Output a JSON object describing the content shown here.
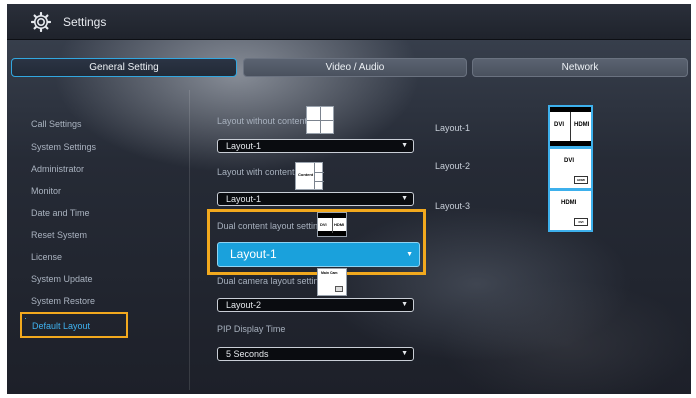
{
  "window": {
    "title": "Settings",
    "icon": "gear-icon"
  },
  "tabs": [
    {
      "label": "General Setting",
      "active": true
    },
    {
      "label": "Video / Audio",
      "active": false
    },
    {
      "label": "Network",
      "active": false
    }
  ],
  "sidebar": {
    "items": [
      {
        "label": "Call Settings"
      },
      {
        "label": "System Settings"
      },
      {
        "label": "Administrator"
      },
      {
        "label": "Monitor"
      },
      {
        "label": "Date and Time"
      },
      {
        "label": "Reset System"
      },
      {
        "label": "License"
      },
      {
        "label": "System Update"
      },
      {
        "label": "System Restore"
      },
      {
        "label": "Default Layout",
        "active": true
      }
    ]
  },
  "form": {
    "layout_without_content": {
      "label": "Layout without content",
      "value": "Layout-1"
    },
    "layout_with_content": {
      "label": "Layout with content",
      "value": "Layout-1",
      "thumb_text": "Content"
    },
    "dual_content_layout": {
      "label": "Dual content layout setting",
      "value": "Layout-1",
      "thumb_text_left": "DVI",
      "thumb_text_right": "HDMI"
    },
    "dual_camera_layout": {
      "label": "Dual camera layout setting",
      "value": "Layout-2",
      "thumb_text": "Main Cam"
    },
    "pip_display_time": {
      "label": "PIP Display Time",
      "value": "5 Seconds"
    }
  },
  "layouts": [
    {
      "name": "Layout-1",
      "primary": "DVI",
      "secondary": "HDMI"
    },
    {
      "name": "Layout-2",
      "primary": "DVI",
      "secondary": "HDMI"
    },
    {
      "name": "Layout-3",
      "primary": "HDMI",
      "secondary": "DVI"
    }
  ],
  "colors": {
    "accent": "#1aa1dc",
    "highlight": "#f2a91e",
    "active_text": "#3fb2f0"
  }
}
